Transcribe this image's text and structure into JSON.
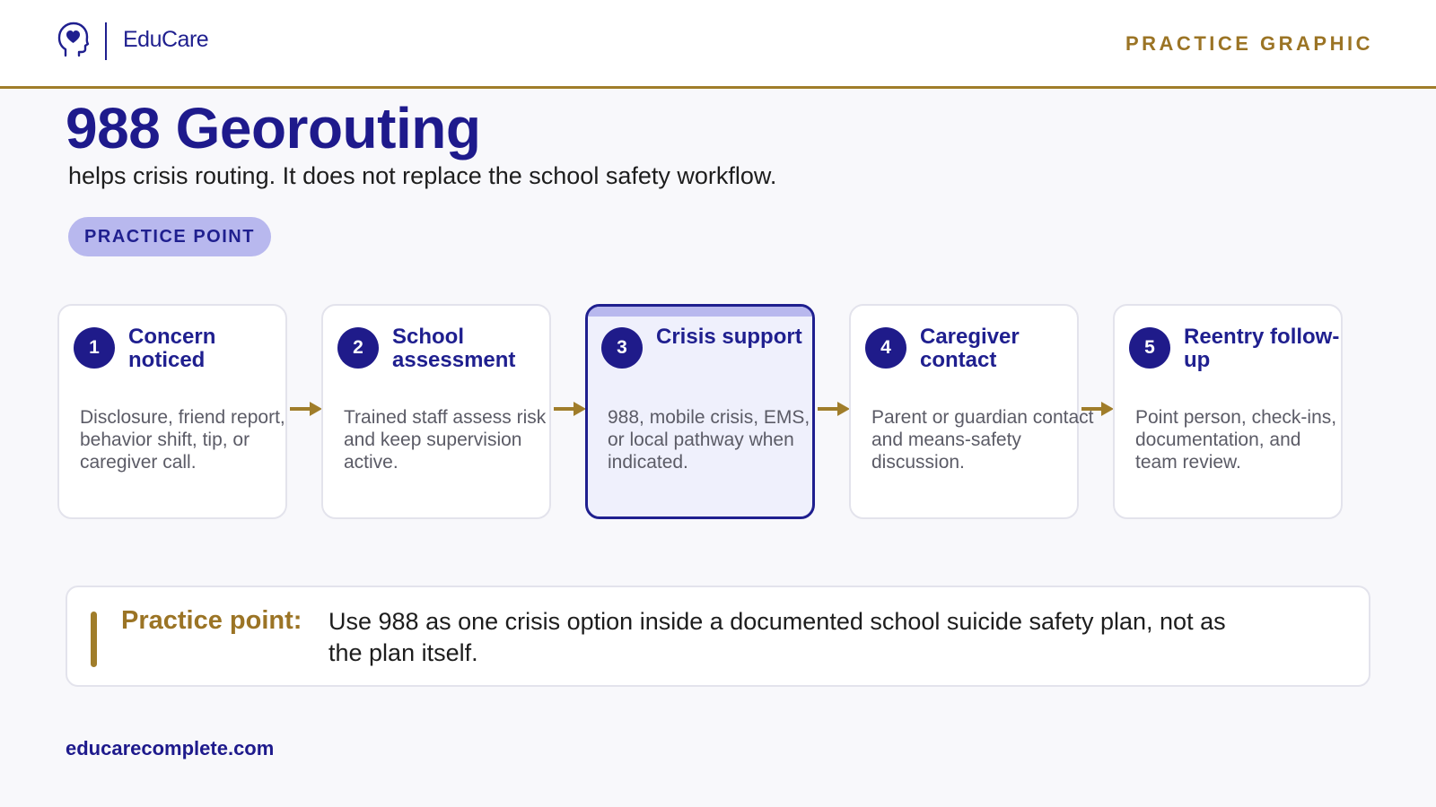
{
  "header": {
    "brand": "EduCare",
    "tag": "PRACTICE GRAPHIC"
  },
  "title": "988 Georouting",
  "subtitle": "helps crisis routing. It does not replace the school safety workflow.",
  "pill": "PRACTICE POINT",
  "steps": [
    {
      "num": "1",
      "title": "Concern noticed",
      "desc": "Disclosure, friend report, behavior shift, tip, or caregiver call."
    },
    {
      "num": "2",
      "title": "School assessment",
      "desc": "Trained staff assess risk and keep supervision active."
    },
    {
      "num": "3",
      "title": "Crisis support",
      "desc": "988, mobile crisis, EMS, or local pathway when indicated."
    },
    {
      "num": "4",
      "title": "Caregiver contact",
      "desc": "Parent or guardian contact and means-safety discussion."
    },
    {
      "num": "5",
      "title": "Reentry follow-up",
      "desc": "Point person, check-ins, documentation, and team review."
    }
  ],
  "note": {
    "label": "Practice point:",
    "text": "Use 988 as one crisis option inside a documented school suicide safety plan, not as the plan itself."
  },
  "footer": "educarecomplete.com",
  "colors": {
    "navy": "#1f1f8f",
    "gold": "#a07d2a",
    "lavender": "#b8b8ee",
    "highlight_bg": "#eff0fc"
  },
  "icons": {
    "logo": "head-heart-icon",
    "connector": "arrow-right-icon"
  }
}
